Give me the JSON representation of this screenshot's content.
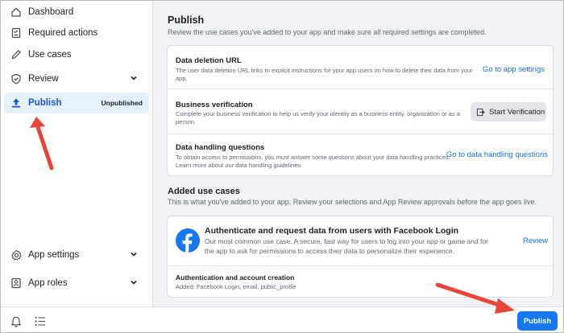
{
  "sidebar": {
    "items": [
      {
        "label": "Dashboard",
        "icon": "home-icon"
      },
      {
        "label": "Required actions",
        "icon": "checklist-icon"
      },
      {
        "label": "Use cases",
        "icon": "pencil-icon"
      },
      {
        "label": "Review",
        "icon": "shield-check-icon"
      },
      {
        "label": "Publish",
        "icon": "upload-icon",
        "badge": "Unpublished"
      },
      {
        "label": "App settings",
        "icon": "gear-icon"
      },
      {
        "label": "App roles",
        "icon": "person-card-icon"
      }
    ]
  },
  "publish": {
    "title": "Publish",
    "subtitle": "Review the use cases you've added to your app and make sure all required settings are completed.",
    "rows": [
      {
        "title": "Data deletion URL",
        "desc": "The user data deletion URL links to explicit instructions for your app users on how to delete their data from your app.",
        "action": "Go to app settings"
      },
      {
        "title": "Business verification",
        "desc": "Complete your business verification to help us verify your identity as a business entity, organization or as a person.",
        "action": "Start Verification"
      },
      {
        "title": "Data handling questions",
        "desc": "To obtain access to permissions, you must answer some questions about your data handling practices. Learn more about our data handling guidelines.",
        "action": "Go to data handling questions"
      }
    ]
  },
  "added": {
    "title": "Added use cases",
    "subtitle": "This is what you've added to your app. Review your selections and App Review approvals before the app goes live.",
    "usecase": {
      "title": "Authenticate and request data from users with Facebook Login",
      "desc": "Our most common use case. A secure, fast way for users to log into your app or game and for the app to ask for permissions to access their data to personalize their experience.",
      "action": "Review"
    },
    "auth": {
      "title": "Authentication and account creation",
      "desc": "Added: Facebook Login, email, public_profile"
    }
  },
  "footer": {
    "publish_label": "Publish"
  },
  "colors": {
    "accent": "#1877f2",
    "annotation_arrow": "#e8443a",
    "active_bg": "#e7f0fd"
  }
}
